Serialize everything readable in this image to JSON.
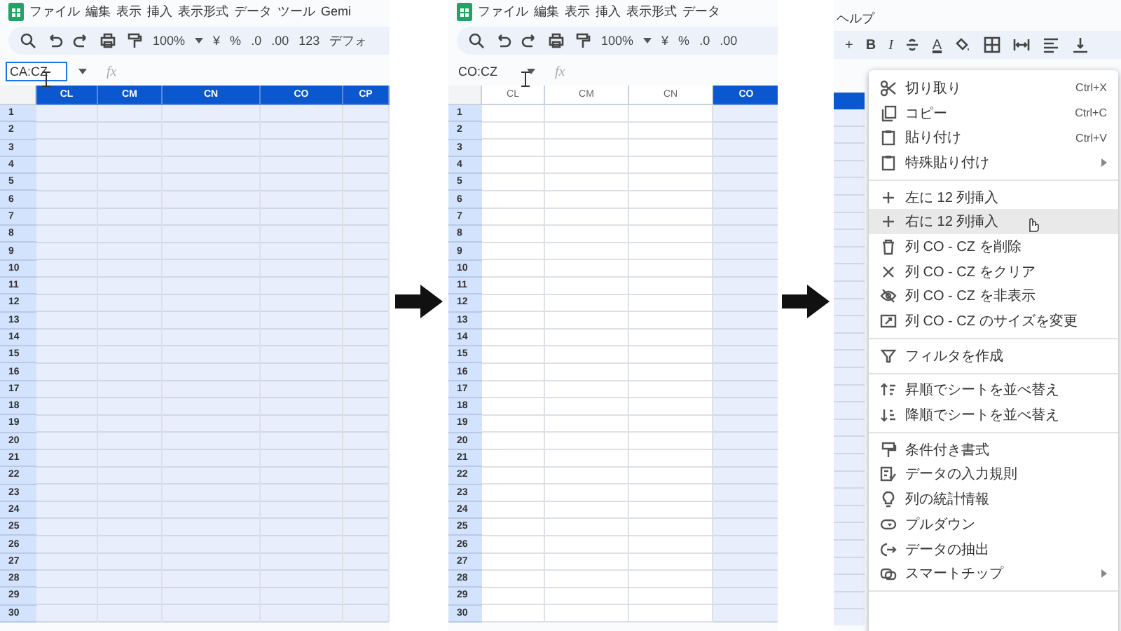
{
  "panels": [
    {
      "menu": [
        "ファイル",
        "編集",
        "表示",
        "挿入",
        "表示形式",
        "データ",
        "ツール",
        "Gemi"
      ],
      "toolbar": [
        "100%",
        "¥",
        "%",
        ".0",
        ".00",
        "123",
        "デフォ"
      ],
      "name_box": {
        "value": "CA:CZ",
        "focused": true
      },
      "formula_label": "fx",
      "columns": [
        {
          "label": "CL",
          "selected": true
        },
        {
          "label": "CM",
          "selected": true
        },
        {
          "label": "CN",
          "selected": true
        },
        {
          "label": "CO",
          "selected": true
        },
        {
          "label": "CP",
          "selected": true
        }
      ],
      "rows": [
        "1",
        "2",
        "3",
        "4",
        "5",
        "6",
        "7",
        "8",
        "9",
        "10",
        "11",
        "12",
        "13",
        "14",
        "15",
        "16",
        "17",
        "18",
        "19",
        "20",
        "21",
        "22",
        "23",
        "24",
        "25",
        "26",
        "27",
        "28",
        "29",
        "30"
      ]
    },
    {
      "menu": [
        "ファイル",
        "編集",
        "表示",
        "挿入",
        "表示形式",
        "データ"
      ],
      "toolbar": [
        "100%",
        "¥",
        "%",
        ".0",
        ".00"
      ],
      "name_box": {
        "value": "CO:CZ",
        "focused": false
      },
      "formula_label": "fx",
      "columns": [
        {
          "label": "CL",
          "selected": false
        },
        {
          "label": "CM",
          "selected": false
        },
        {
          "label": "CN",
          "selected": false
        },
        {
          "label": "CO",
          "selected": true
        }
      ],
      "rows": [
        "1",
        "2",
        "3",
        "4",
        "5",
        "6",
        "7",
        "8",
        "9",
        "10",
        "11",
        "12",
        "13",
        "14",
        "15",
        "16",
        "17",
        "18",
        "19",
        "20",
        "21",
        "22",
        "23",
        "24",
        "25",
        "26",
        "27",
        "28",
        "29",
        "30"
      ]
    }
  ],
  "panel3": {
    "menu": [
      "ヘルプ"
    ],
    "toolbar": [
      "+",
      "B",
      "I",
      "A"
    ],
    "context_menu": [
      [
        {
          "label": "切り取り",
          "shortcut": "Ctrl+X",
          "submenu": false,
          "selected": false
        },
        {
          "label": "コピー",
          "shortcut": "Ctrl+C",
          "submenu": false,
          "selected": false
        },
        {
          "label": "貼り付け",
          "shortcut": "Ctrl+V",
          "submenu": false,
          "selected": false
        },
        {
          "label": "特殊貼り付け",
          "submenu": true,
          "selected": false
        }
      ],
      [
        {
          "label": "左に 12 列挿入",
          "submenu": false,
          "selected": false
        },
        {
          "label": "右に 12 列挿入",
          "submenu": false,
          "selected": true
        },
        {
          "label": "列 CO - CZ を削除",
          "submenu": false,
          "selected": false
        },
        {
          "label": "列 CO - CZ をクリア",
          "submenu": false,
          "selected": false
        },
        {
          "label": "列 CO - CZ を非表示",
          "submenu": false,
          "selected": false
        },
        {
          "label": "列 CO - CZ のサイズを変更",
          "submenu": false,
          "selected": false
        }
      ],
      [
        {
          "label": "フィルタを作成",
          "submenu": false,
          "selected": false
        }
      ],
      [
        {
          "label": "昇順でシートを並べ替え",
          "submenu": false,
          "selected": false
        },
        {
          "label": "降順でシートを並べ替え",
          "submenu": false,
          "selected": false
        }
      ],
      [
        {
          "label": "条件付き書式",
          "submenu": false,
          "selected": false
        },
        {
          "label": "データの入力規則",
          "submenu": false,
          "selected": false
        },
        {
          "label": "列の統計情報",
          "submenu": false,
          "selected": false
        },
        {
          "label": "プルダウン",
          "submenu": false,
          "selected": false
        },
        {
          "label": "データの抽出",
          "submenu": false,
          "selected": false
        },
        {
          "label": "スマートチップ",
          "submenu": true,
          "selected": false
        }
      ]
    ]
  }
}
